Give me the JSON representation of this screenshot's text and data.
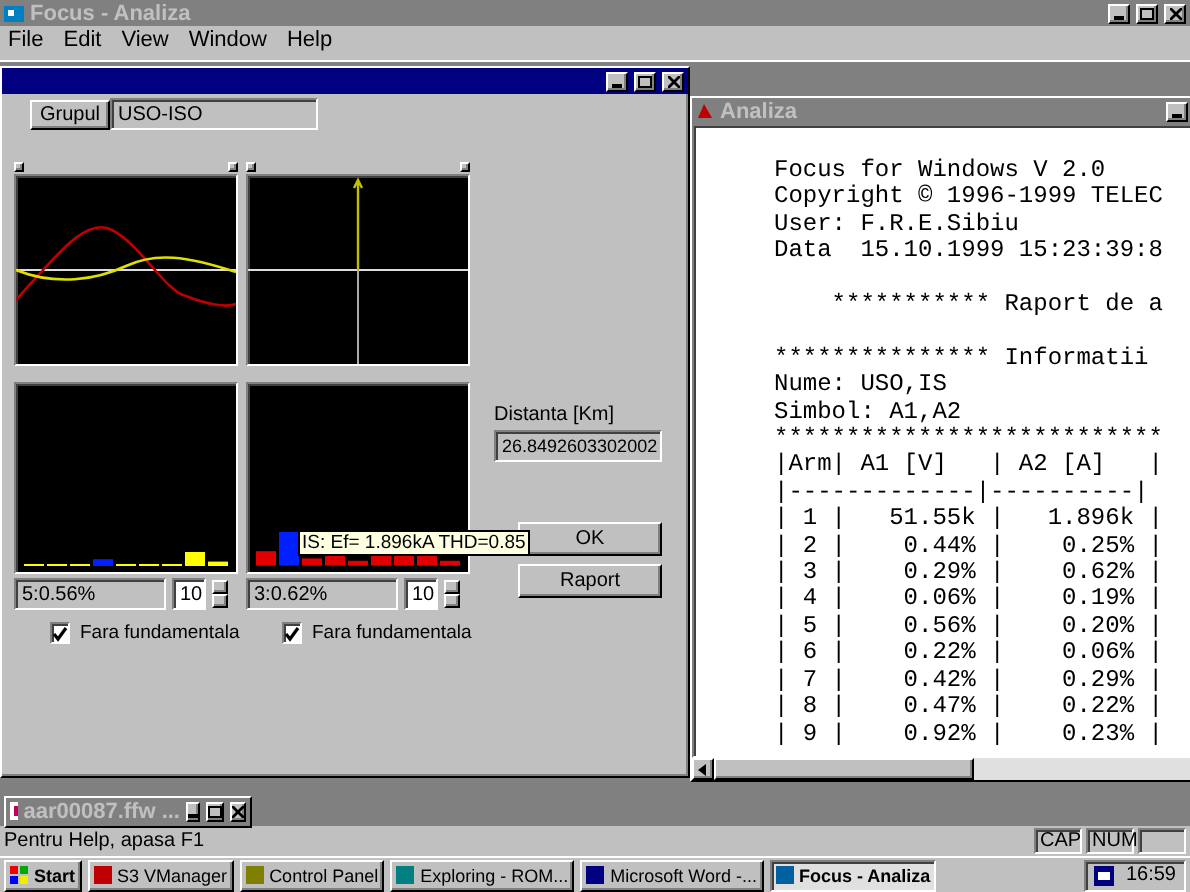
{
  "app": {
    "title": "Focus - Analiza"
  },
  "menu": [
    "File",
    "Edit",
    "View",
    "Window",
    "Help"
  ],
  "analysis_window": {
    "group_button": "Grupul",
    "group_value": "USO-ISO",
    "spectra": [
      {
        "readout": "5:0.56%",
        "count": "10",
        "option": {
          "label": "Fara fundamentala",
          "checked": true
        }
      },
      {
        "readout": "3:0.62%",
        "count": "10",
        "tooltip": "IS: Ef= 1.896kA THD=0.85",
        "option": {
          "label": "Fara fundamentala",
          "checked": true
        }
      }
    ],
    "distance": {
      "label": "Distanta [Km]",
      "value": "26.8492603302002"
    },
    "buttons": [
      "OK",
      "Raport"
    ]
  },
  "report_window": {
    "title": "Analiza",
    "blocks": [
      [
        "Focus for Windows V 2.0",
        "Copyright © 1996-1999 TELEC",
        "User: F.R.E.Sibiu",
        "Data  15.10.1999 15:23:39:8"
      ],
      [
        "    *********** Raport de a"
      ],
      [
        "*************** Informatii",
        "Nume: USO,IS",
        "Simbol: A1,A2",
        "***************************",
        "|Arm| A1 [V]   | A2 [A]   |",
        "|-------------|----------|",
        "| 1 |   51.55k |   1.896k |",
        "| 2 |    0.44% |    0.25% |",
        "| 3 |    0.29% |    0.62% |",
        "| 4 |    0.06% |    0.19% |",
        "| 5 |    0.56% |    0.20% |",
        "| 6 |    0.22% |    0.06% |",
        "| 7 |    0.42% |    0.29% |",
        "| 8 |    0.47% |    0.22% |",
        "| 9 |    0.92% |    0.23% |"
      ]
    ]
  },
  "minimized_window": {
    "title": "aar00087.ffw ..."
  },
  "status_bar": {
    "message": "Pentru Help, apasa F1",
    "indicators": [
      "CAP",
      "NUM"
    ]
  },
  "taskbar": {
    "start": "Start",
    "tasks": [
      {
        "label": "S3 VManager",
        "selected": false
      },
      {
        "label": "Control Panel",
        "selected": false
      },
      {
        "label": "Exploring - ROM...",
        "selected": false
      },
      {
        "label": "Microsoft Word -...",
        "selected": false
      },
      {
        "label": "Focus - Analiza",
        "selected": true
      }
    ],
    "clock": "16:59"
  }
}
